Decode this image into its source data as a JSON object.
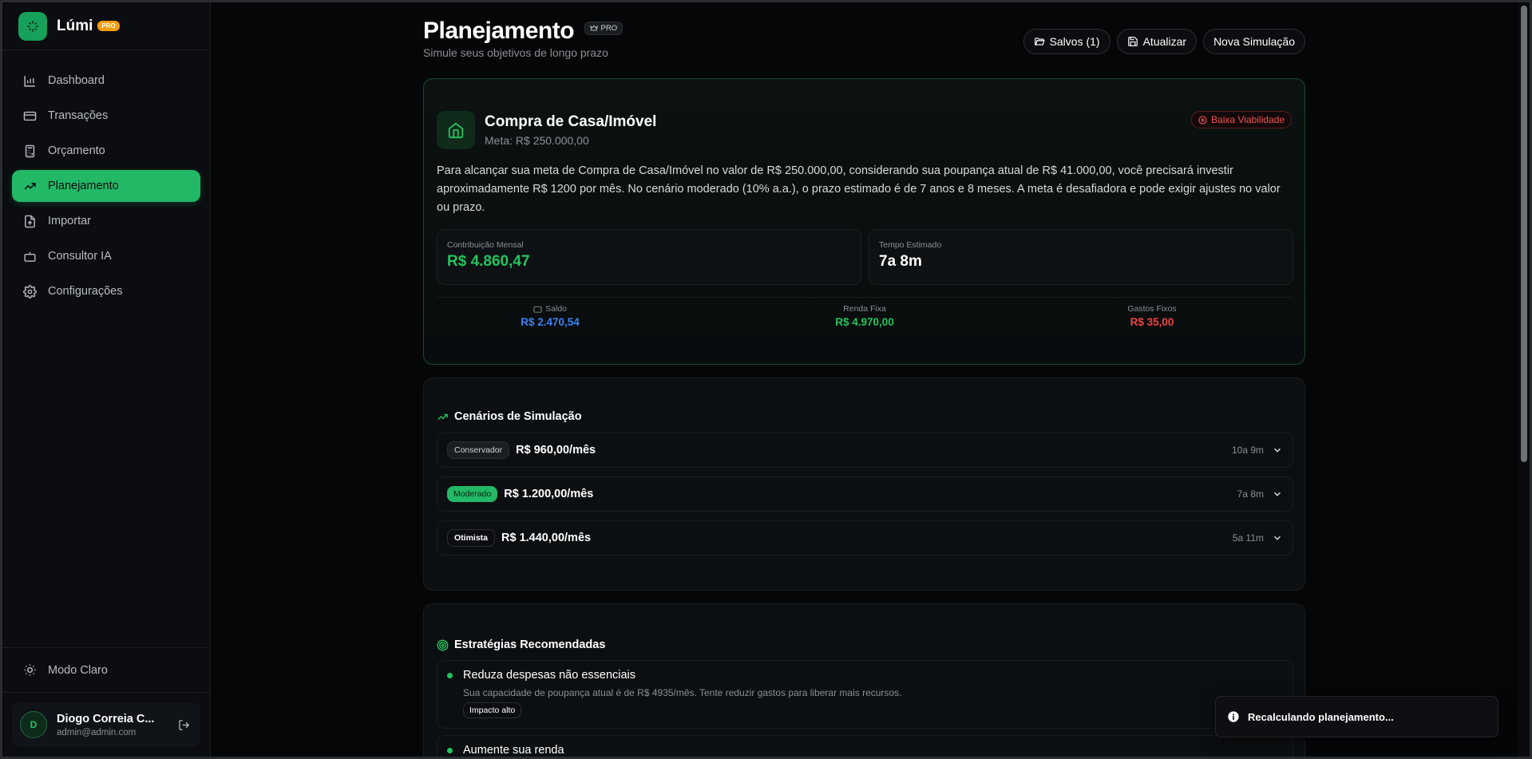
{
  "brand": {
    "name": "Lúmi",
    "badge": "PRO"
  },
  "nav": {
    "items": [
      {
        "label": "Dashboard",
        "icon": "bar-chart-icon"
      },
      {
        "label": "Transações",
        "icon": "credit-card-icon"
      },
      {
        "label": "Orçamento",
        "icon": "calculator-icon"
      },
      {
        "label": "Planejamento",
        "icon": "trending-up-icon",
        "active": true
      },
      {
        "label": "Importar",
        "icon": "file-upload-icon"
      },
      {
        "label": "Consultor IA",
        "icon": "bot-icon"
      },
      {
        "label": "Configurações",
        "icon": "gear-icon"
      }
    ],
    "theme_toggle": "Modo Claro"
  },
  "user": {
    "initial": "D",
    "name": "Diogo Correia C...",
    "email": "admin@admin.com"
  },
  "header": {
    "title": "Planejamento",
    "badge": "PRO",
    "subtitle": "Simule seus objetivos de longo prazo",
    "actions": {
      "saved": "Salvos (1)",
      "refresh": "Atualizar",
      "new": "Nova Simulação"
    }
  },
  "goal": {
    "title": "Compra de Casa/Imóvel",
    "target": "Meta: R$ 250.000,00",
    "viability": "Baixa Viabilidade",
    "description": "Para alcançar sua meta de Compra de Casa/Imóvel no valor de R$ 250.000,00, considerando sua poupança atual de R$ 41.000,00, você precisará investir aproximadamente R$ 1200 por mês. No cenário moderado (10% a.a.), o prazo estimado é de 7 anos e 8 meses. A meta é desafiadora e pode exigir ajustes no valor ou prazo.",
    "stats": {
      "monthly_label": "Contribuição Mensal",
      "monthly_value": "R$ 4.860,47",
      "time_label": "Tempo Estimado",
      "time_value": "7a 8m"
    },
    "summary": {
      "balance_label": "Saldo",
      "balance_value": "R$ 2.470,54",
      "income_label": "Renda Fixa",
      "income_value": "R$ 4.970,00",
      "expenses_label": "Gastos Fixos",
      "expenses_value": "R$ 35,00"
    }
  },
  "scenarios": {
    "title": "Cenários de Simulação",
    "items": [
      {
        "name": "Conservador",
        "amount": "R$ 960,00/mês",
        "time": "10a 9m"
      },
      {
        "name": "Moderado",
        "amount": "R$ 1.200,00/mês",
        "time": "7a 8m"
      },
      {
        "name": "Otimista",
        "amount": "R$ 1.440,00/mês",
        "time": "5a 11m"
      }
    ]
  },
  "strategies": {
    "title": "Estratégias Recomendadas",
    "items": [
      {
        "title": "Reduza despesas não essenciais",
        "description": "Sua capacidade de poupança atual é de R$ 4935/mês. Tente reduzir gastos para liberar mais recursos.",
        "impact": "Impacto alto"
      },
      {
        "title": "Aumente sua renda"
      }
    ]
  },
  "toast": {
    "message": "Recalculando planejamento..."
  },
  "colors": {
    "accent": "#22c55e",
    "danger": "#ef4444",
    "info": "#3b82f6",
    "pro": "#f59e0b"
  }
}
